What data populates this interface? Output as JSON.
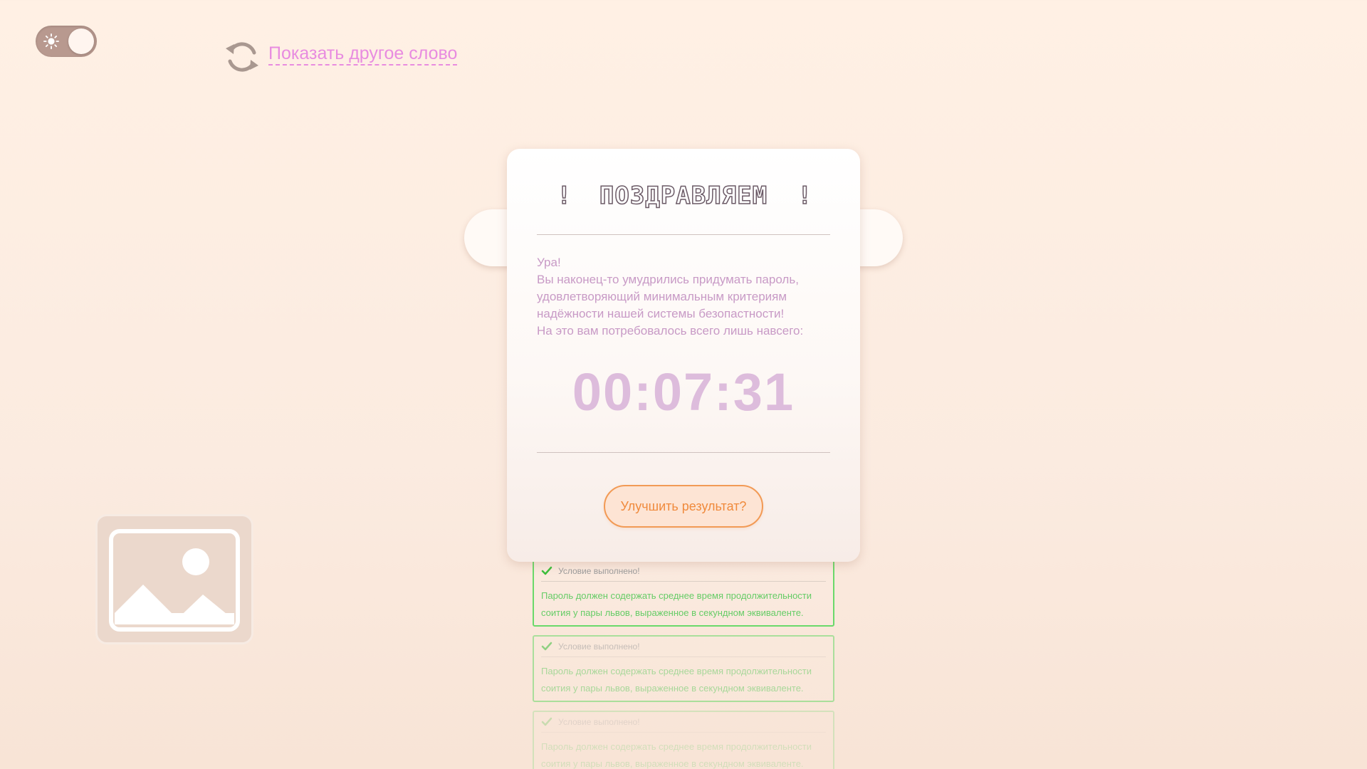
{
  "header": {
    "theme_toggle": {
      "icon": "sun-icon",
      "state": "light"
    },
    "refresh": {
      "icon": "refresh-icon",
      "label": "Показать другое слово"
    }
  },
  "modal": {
    "title": "ПОЗДРАВЛЯЕМ",
    "title_left_mark": "!",
    "title_right_mark": "!",
    "message_lines": [
      "Ура!",
      "Вы наконец-то умудрились придумать пароль,",
      "удовлетворяющий минимальным критериям",
      "надёжности нашей системы безопастности!",
      "На это вам потребовалось всего лишь навсего:"
    ],
    "timer": "00:07:31",
    "improve_button": "Улучшить результат?"
  },
  "conditions": [
    {
      "status": "Условие выполнено!",
      "text_line1": "Пароль должен содержать среднее время продолжительности",
      "text_line2": "соития у пары львов, выраженное в секундном эквиваленте."
    },
    {
      "status": "Условие выполнено!",
      "text_line1": "Пароль должен содержать среднее время продолжительности",
      "text_line2": "соития у пары львов, выраженное в секундном эквиваленте."
    },
    {
      "status": "Условие выполнено!",
      "text_line1": "Пароль должен содержать среднее время продолжительности",
      "text_line2": "соития у пары львов, выраженное в секундном эквиваленте."
    }
  ],
  "image_placeholder": {
    "icon": "image-icon"
  },
  "colors": {
    "accent_pink": "#e88ce0",
    "timer": "#ddbcdc",
    "button_orange": "#f08a3c",
    "condition_green": "#6ad96a"
  }
}
